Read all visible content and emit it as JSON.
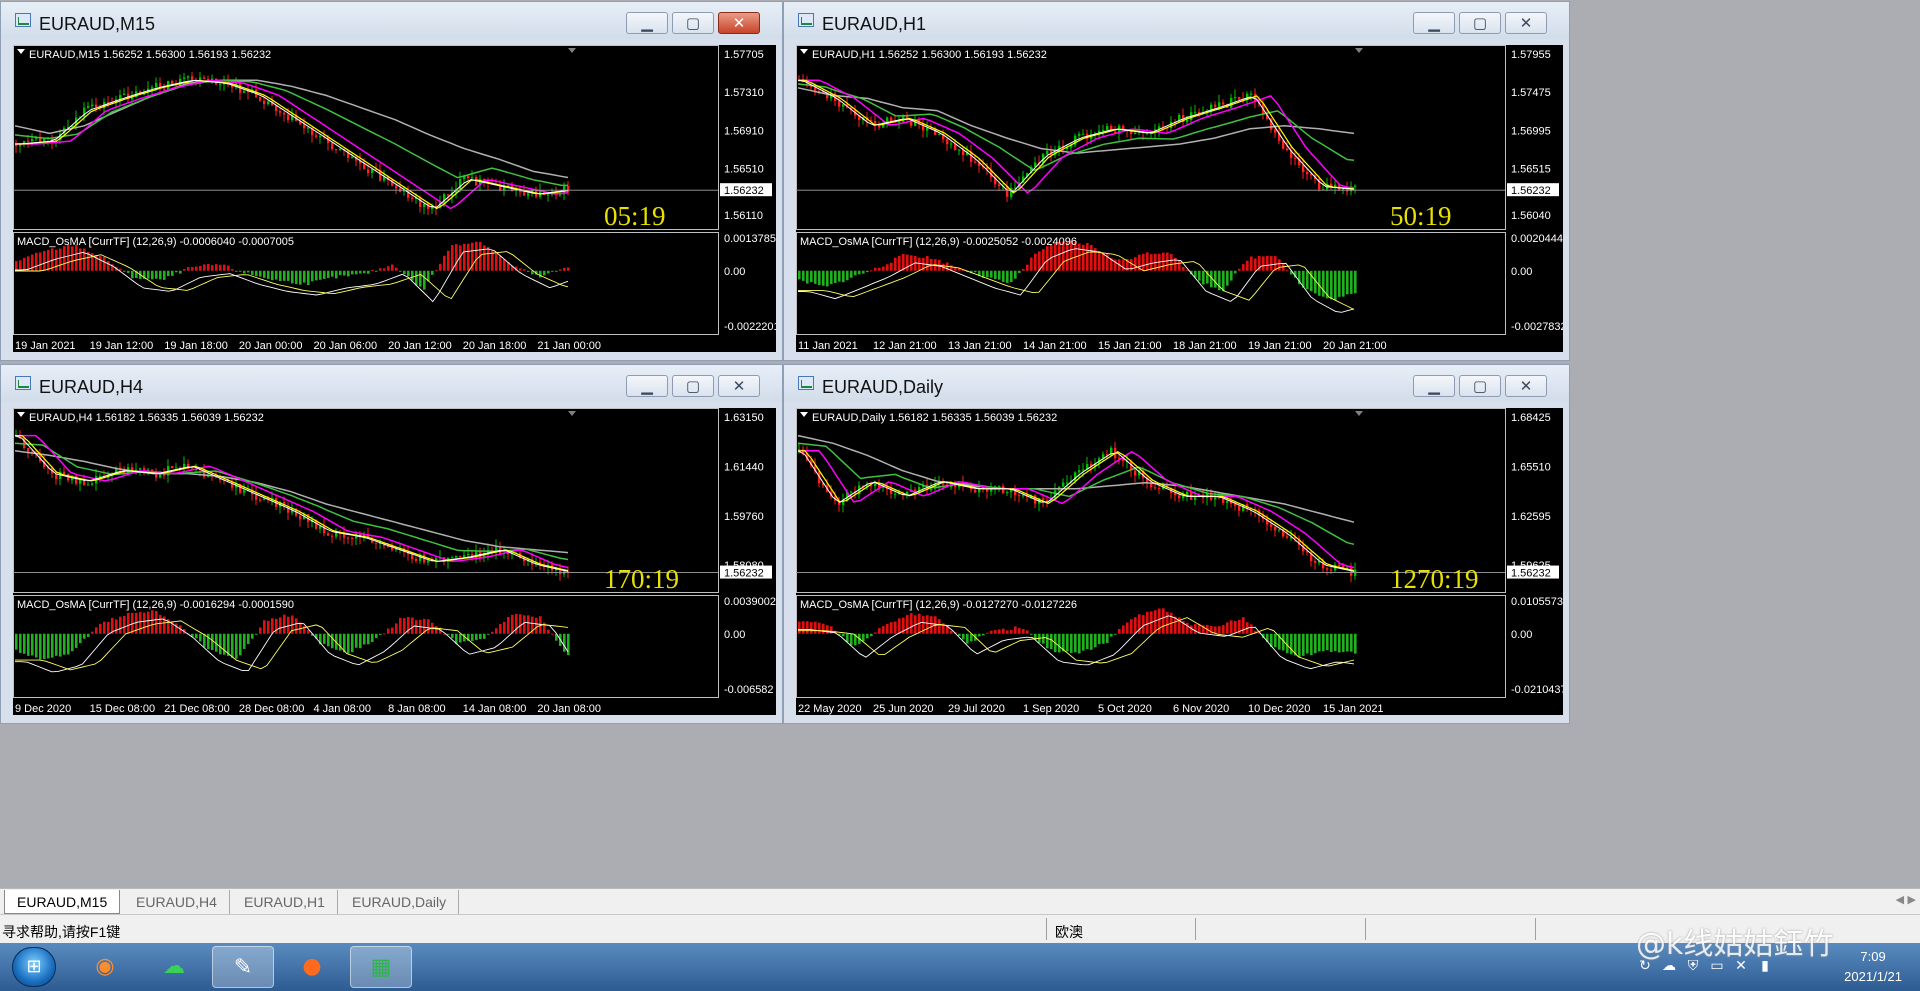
{
  "windows": [
    {
      "id": "m15",
      "title": "EURAUD,M15",
      "close_active": true,
      "info_line": "EURAUD,M15  1.56252 1.56300 1.56193 1.56232",
      "price_axis": [
        "1.57705",
        "1.57310",
        "1.56910",
        "1.56510",
        "1.56232",
        "1.56110"
      ],
      "countdown": "05:19",
      "macd_label": "MACD_OsMA [CurrTF] (12,26,9) -0.0006040 -0.0007005",
      "macd_axis": [
        "0.0013785",
        "0.00",
        "-0.0022201"
      ],
      "time_axis": [
        "19 Jan 2021",
        "19 Jan 12:00",
        "19 Jan 18:00",
        "20 Jan 00:00",
        "20 Jan 06:00",
        "20 Jan 12:00",
        "20 Jan 18:00",
        "21 Jan 00:00"
      ]
    },
    {
      "id": "h1",
      "title": "EURAUD,H1",
      "close_active": false,
      "info_line": "EURAUD,H1  1.56252 1.56300 1.56193 1.56232",
      "price_axis": [
        "1.57955",
        "1.57475",
        "1.56995",
        "1.56515",
        "1.56232",
        "1.56040"
      ],
      "countdown": "50:19",
      "macd_label": "MACD_OsMA [CurrTF] (12,26,9) -0.0025052 -0.0024096",
      "macd_axis": [
        "0.0020444",
        "0.00",
        "-0.0027832"
      ],
      "time_axis": [
        "11 Jan 2021",
        "12 Jan 21:00",
        "13 Jan 21:00",
        "14 Jan 21:00",
        "15 Jan 21:00",
        "18 Jan 21:00",
        "19 Jan 21:00",
        "20 Jan 21:00"
      ]
    },
    {
      "id": "h4",
      "title": "EURAUD,H4",
      "close_active": false,
      "info_line": "EURAUD,H4  1.56182 1.56335 1.56039 1.56232",
      "price_axis": [
        "1.63150",
        "1.61440",
        "1.59760",
        "1.58080",
        "1.56232"
      ],
      "countdown": "170:19",
      "macd_label": "MACD_OsMA [CurrTF] (12,26,9) -0.0016294 -0.0001590",
      "macd_axis": [
        "0.0039002",
        "0.00",
        "-0.006582"
      ],
      "time_axis": [
        "9 Dec 2020",
        "15 Dec 08:00",
        "21 Dec 08:00",
        "28 Dec 08:00",
        "4 Jan 08:00",
        "8 Jan 08:00",
        "14 Jan 08:00",
        "20 Jan 08:00"
      ]
    },
    {
      "id": "daily",
      "title": "EURAUD,Daily",
      "close_active": false,
      "info_line": "EURAUD,Daily  1.56182 1.56335 1.56039 1.56232",
      "price_axis": [
        "1.68425",
        "1.65510",
        "1.62595",
        "1.59625",
        "1.56232"
      ],
      "countdown": "1270:19",
      "macd_label": "MACD_OsMA [CurrTF] (12,26,9) -0.0127270 -0.0127226",
      "macd_axis": [
        "0.0105573",
        "0.00",
        "-0.0210437"
      ],
      "time_axis": [
        "22 May 2020",
        "25 Jun 2020",
        "29 Jul 2020",
        "1 Sep 2020",
        "5 Oct 2020",
        "6 Nov 2020",
        "10 Dec 2020",
        "15 Jan 2021"
      ]
    }
  ],
  "tabs": [
    {
      "label": "EURAUD,M15",
      "active": true
    },
    {
      "label": "EURAUD,H4",
      "active": false
    },
    {
      "label": "EURAUD,H1",
      "active": false
    },
    {
      "label": "EURAUD,Daily",
      "active": false
    }
  ],
  "status": {
    "help_text": "寻求帮助,请按F1键",
    "profile": "欧澳"
  },
  "tray": {
    "time": "7:09",
    "date": "2021/1/21"
  },
  "watermark": "@k线姑姑鈺竹",
  "colors": {
    "bull": "#00c000",
    "bear": "#ff2020",
    "ma_fast": "#ffff00",
    "ma_white": "#ffffff",
    "ma_magenta": "#ff00ff",
    "ma_green": "#40c040",
    "ma_grey": "#b0b0b0",
    "hist_pos": "#e01010",
    "hist_neg": "#20b020",
    "countdown": "#e8e000"
  }
}
